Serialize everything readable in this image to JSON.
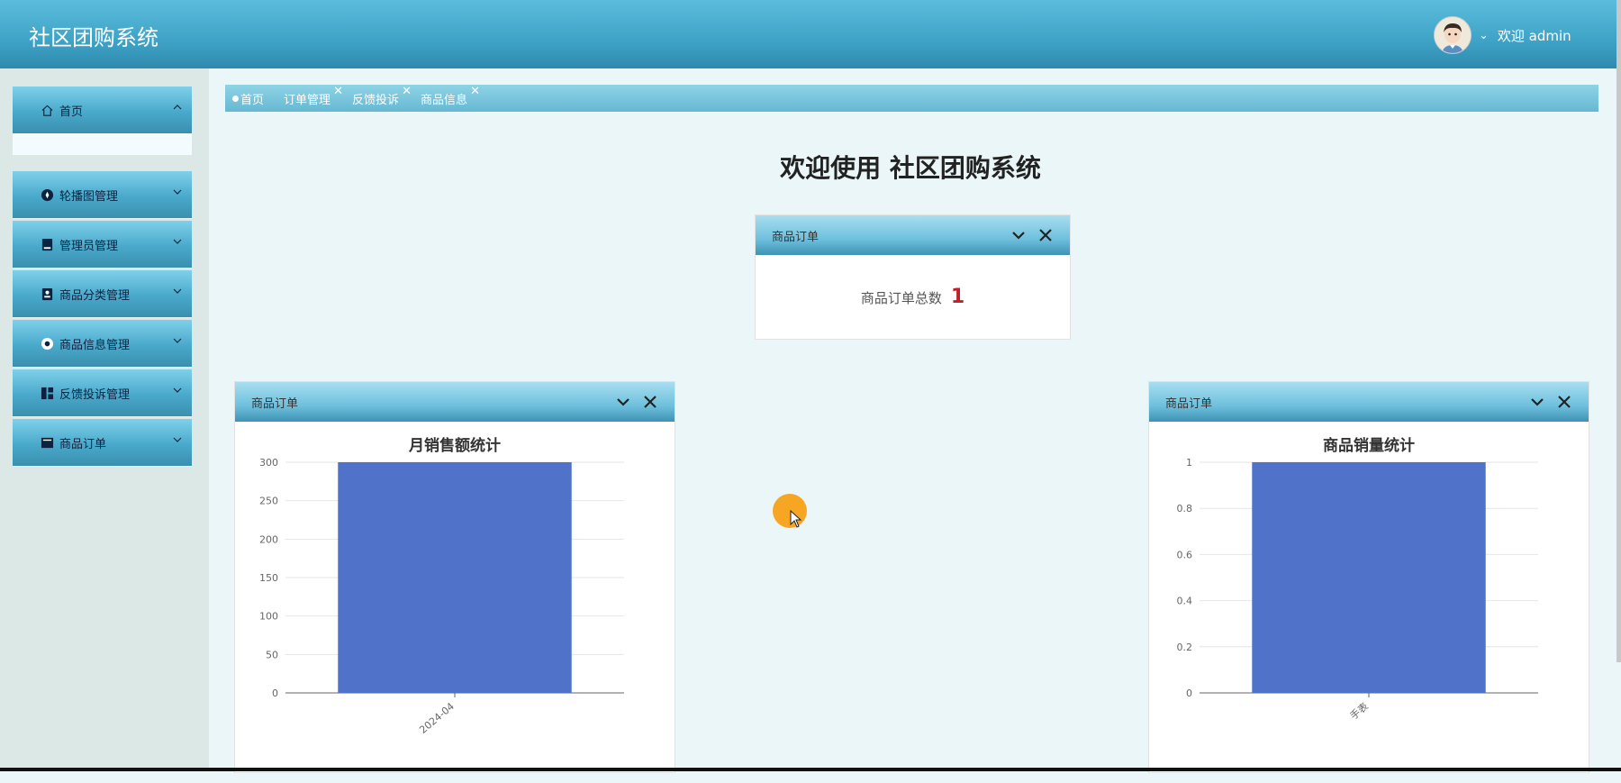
{
  "header": {
    "app_title": "社区团购系统",
    "welcome_text": "欢迎 admin"
  },
  "tabs": [
    {
      "label": "首页",
      "active": true
    },
    {
      "label": "订单管理",
      "closable": true
    },
    {
      "label": "反馈投诉",
      "closable": true
    },
    {
      "label": "商品信息",
      "closable": true
    }
  ],
  "sidebar": {
    "items": [
      {
        "label": "首页",
        "icon": "home-icon"
      },
      {
        "label": "轮播图管理",
        "icon": "carousel-icon"
      },
      {
        "label": "管理员管理",
        "icon": "admin-icon"
      },
      {
        "label": "商品分类管理",
        "icon": "category-icon"
      },
      {
        "label": "商品信息管理",
        "icon": "goods-info-icon"
      },
      {
        "label": "反馈投诉管理",
        "icon": "feedback-icon"
      },
      {
        "label": "商品订单",
        "icon": "order-icon"
      }
    ]
  },
  "main": {
    "welcome_title": "欢迎使用 社区团购系统",
    "count_panel": {
      "title": "商品订单",
      "count_label": "商品订单总数",
      "count_value": "1"
    },
    "left_panel": {
      "title": "商品订单"
    },
    "right_panel": {
      "title": "商品订单"
    }
  },
  "colors": {
    "bar": "#5072c9",
    "count_value": "#c0202a",
    "header": "#3ea3c7"
  },
  "chart_data": [
    {
      "type": "bar",
      "title": "月销售额统计",
      "categories": [
        "2024-04"
      ],
      "values": [
        300
      ],
      "ylim": [
        0,
        300
      ],
      "yticks": [
        0,
        50,
        100,
        150,
        200,
        250,
        300
      ],
      "grid": true
    },
    {
      "type": "bar",
      "title": "商品销量统计",
      "categories": [
        "手表"
      ],
      "values": [
        1
      ],
      "ylim": [
        0,
        1
      ],
      "yticks": [
        0,
        0.2,
        0.4,
        0.6,
        0.8,
        1
      ],
      "grid": true
    }
  ]
}
